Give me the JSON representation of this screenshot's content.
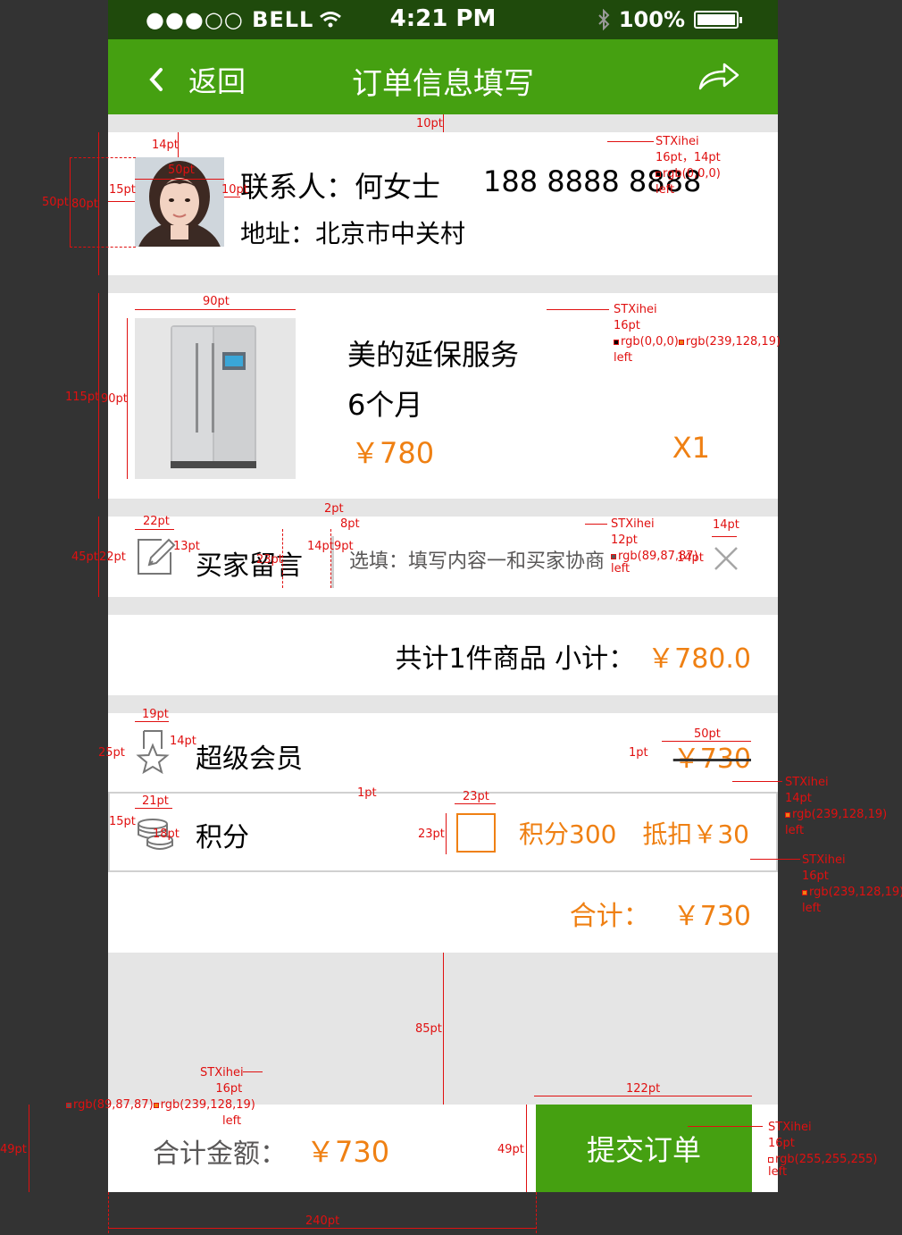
{
  "status_bar": {
    "carrier": "●●●○○ BELL",
    "time": "4:21 PM",
    "battery": "100%"
  },
  "nav": {
    "back_label": "返回",
    "title": "订单信息填写"
  },
  "contact": {
    "name_line": "联系人：何女士",
    "phone": "188 8888 8888",
    "address_line": "地址：北京市中关村"
  },
  "product": {
    "name": "美的延保服务",
    "spec": "6个月",
    "price": "￥780",
    "quantity": "X1"
  },
  "message": {
    "label": "买家留言",
    "placeholder": "选填：填写内容一和买家协商"
  },
  "subtotal": {
    "label": "共计1件商品  小计：",
    "amount": "￥780.0"
  },
  "member": {
    "label": "超级会员",
    "original_price": "￥730"
  },
  "points": {
    "label": "积分",
    "checked": false,
    "points_text": "积分300",
    "deduct_text": "抵扣￥30"
  },
  "total": {
    "label": "合计：",
    "amount": "￥730"
  },
  "bottom": {
    "label": "合计金额：",
    "amount": "￥730",
    "submit_label": "提交订单"
  },
  "colors": {
    "nav_green": "#45a011",
    "status_bar": "#1f4a0c",
    "accent_orange": "#ef8013",
    "secondary_text": "#595757",
    "background": "#e5e5e5",
    "annotation_red": "#e01010"
  },
  "icons": [
    "chevron-left-icon",
    "share-icon",
    "edit-icon",
    "close-icon",
    "star-badge-icon",
    "coins-icon",
    "wifi-icon",
    "bluetooth-icon",
    "battery-icon"
  ],
  "annotations": {
    "gap_top": "10pt",
    "avatar_top": "14pt",
    "avatar_size": "50pt",
    "avatar_left": "15pt",
    "avatar_right": "10pt",
    "contact_height": "80pt",
    "avatar_height": "50pt",
    "contact_font": [
      "STXihei",
      "16pt，14pt",
      "rgb(0,0,0)",
      "left"
    ],
    "product_width": "90pt",
    "product_card": "115pt",
    "product_img": "90pt",
    "product_font": [
      "STXihei",
      "16pt",
      "rgb(0,0,0)",
      "rgb(239,128,19)",
      "left"
    ],
    "msg_icon_w": "22pt",
    "msg_icon_h": "22pt",
    "msg_gap": "13pt",
    "msg_card": "45pt",
    "msg_label_size": "14pt",
    "msg_label_h": "23pt",
    "msg_divider_w": "2pt",
    "msg_divider_gap": "8pt",
    "msg_gap2": "9pt",
    "msg_font": [
      "STXihei",
      "12pt",
      "rgb(89,87,87)",
      "left"
    ],
    "msg_close_h": "14pt",
    "msg_close_w": "14pt",
    "member_icon_w": "19pt",
    "member_icon_h": "25pt",
    "member_gap": "14pt",
    "member_strike": "50pt",
    "strike_line": "1pt",
    "points_border": "1pt",
    "coins_w": "21pt",
    "coins_left": "15pt",
    "coins_h": "18pt",
    "checkbox_w": "23pt",
    "checkbox_h": "23pt",
    "points_font": [
      "STXihei",
      "14pt",
      "rgb(239,128,19)",
      "left"
    ],
    "total_font": [
      "STXihei",
      "16pt",
      "rgb(239,128,19)",
      "left"
    ],
    "gap_bottom": "85pt",
    "bottom_font": [
      "STXihei",
      "16pt",
      "rgb(89,87,87)",
      "rgb(239,128,19)",
      "left"
    ],
    "bottom_h": "49pt",
    "submit_h": "49pt",
    "submit_w": "122pt",
    "submit_font": [
      "STXihei",
      "16pt",
      "rgb(255,255,255)",
      "left"
    ],
    "bottom_w": "240pt"
  }
}
